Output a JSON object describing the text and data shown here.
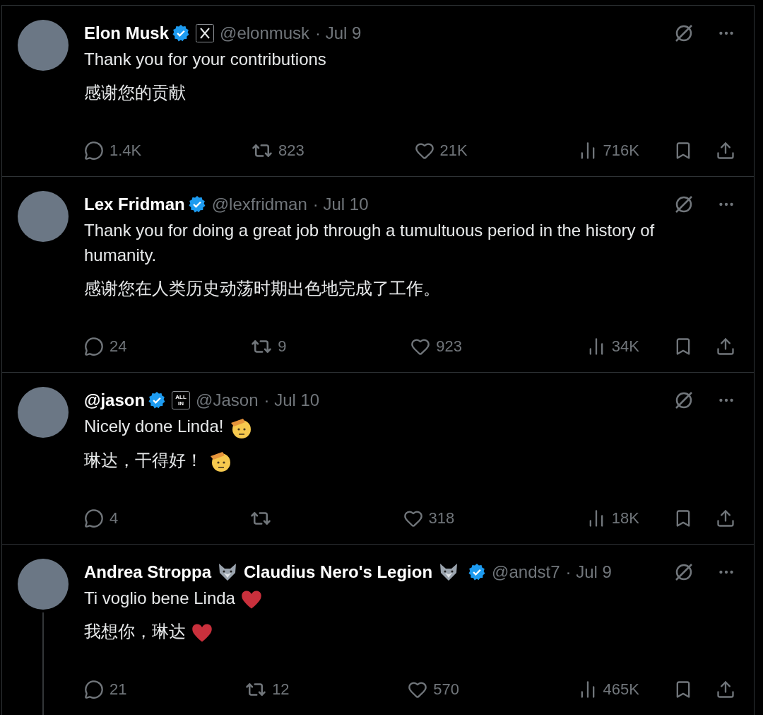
{
  "tweets": [
    {
      "name_segments": [
        {
          "kind": "plain",
          "text": "Elon Musk"
        }
      ],
      "verified": true,
      "affiliate": {
        "kind": "x-logo"
      },
      "handle": "@elonmusk",
      "date": "· Jul 9",
      "lines": [
        {
          "kind": "plain",
          "text": "Thank you for your contributions"
        },
        {
          "kind": "plain",
          "text": "感谢您的贡献"
        }
      ],
      "stats": {
        "replies": "1.4K",
        "reposts": "823",
        "likes": "21K",
        "views": "716K"
      },
      "thread_line": false
    },
    {
      "name_segments": [
        {
          "kind": "plain",
          "text": "Lex Fridman"
        }
      ],
      "verified": true,
      "handle": "@lexfridman",
      "date": "· Jul 10",
      "lines": [
        {
          "kind": "plain",
          "text": "Thank you for doing a great job through a tumultuous period in the history of humanity."
        },
        {
          "kind": "plain",
          "text": "感谢您在人类历史动荡时期出色地完成了工作。"
        }
      ],
      "stats": {
        "replies": "24",
        "reposts": "9",
        "likes": "923",
        "views": "34K"
      },
      "thread_line": false
    },
    {
      "name_segments": [
        {
          "kind": "plain",
          "text": "@jason"
        }
      ],
      "verified": true,
      "affiliate": {
        "kind": "label",
        "text": "ALL IN"
      },
      "handle": "@Jason",
      "date": "· Jul 10",
      "lines": [
        {
          "kind": "salute",
          "text": "Nicely done Linda!"
        },
        {
          "kind": "salute",
          "text": "琳达，干得好！"
        }
      ],
      "stats": {
        "replies": "4",
        "likes": "318",
        "views": "18K"
      },
      "thread_line": false
    },
    {
      "name_segments": [
        {
          "kind": "wolf",
          "text": "Andrea Stroppa"
        },
        {
          "kind": "wolf",
          "text": "Claudius Nero's Legion"
        }
      ],
      "verified": true,
      "handle": "@andst7",
      "date": "· Jul 9",
      "lines": [
        {
          "kind": "heart",
          "text": "Ti voglio bene Linda"
        },
        {
          "kind": "heart",
          "text": "我想你，琳达"
        }
      ],
      "stats": {
        "replies": "21",
        "reposts": "12",
        "likes": "570",
        "views": "465K"
      },
      "thread_line": true
    }
  ]
}
